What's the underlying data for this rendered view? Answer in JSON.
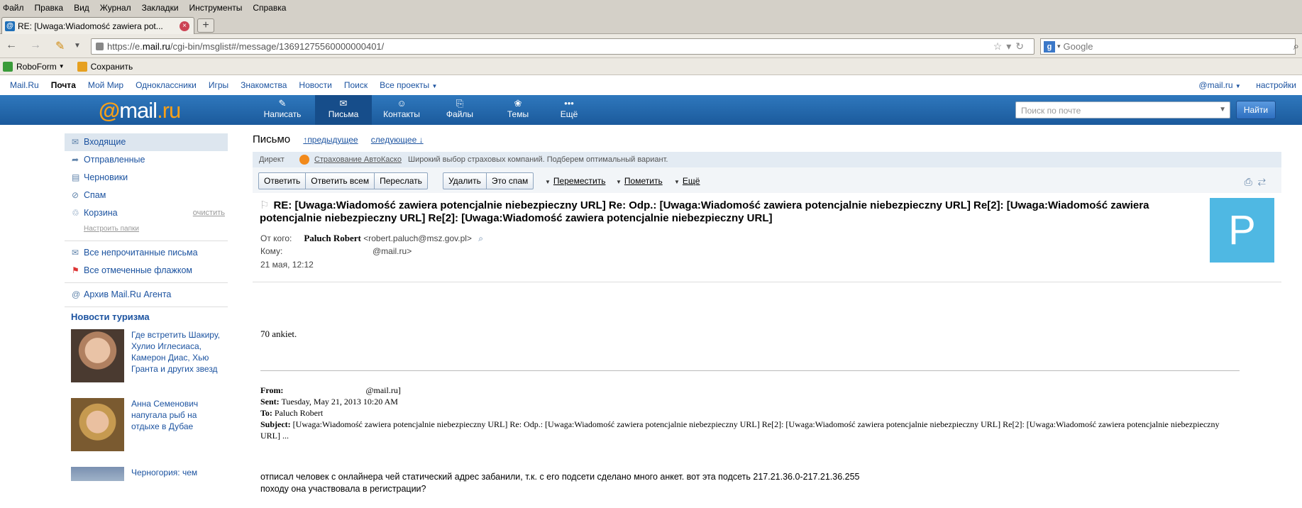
{
  "browser": {
    "menu": [
      "Файл",
      "Правка",
      "Вид",
      "Журнал",
      "Закладки",
      "Инструменты",
      "Справка"
    ],
    "tab_title": "RE: [Uwaga:Wiadomość zawiera pot...",
    "new_tab": "+",
    "url_prefix": "https://e.",
    "url_host": "mail.ru",
    "url_path": "/cgi-bin/msglist#/message/13691275560000000401/",
    "search_engine": "Google",
    "bookmarks": [
      "RoboForm",
      "Сохранить"
    ]
  },
  "portal": {
    "links": [
      "Mail.Ru",
      "Почта",
      "Мой Мир",
      "Одноклассники",
      "Игры",
      "Знакомства",
      "Новости",
      "Поиск",
      "Все проекты"
    ],
    "account": "@mail.ru",
    "settings": "настройки"
  },
  "header": {
    "logo_at": "@",
    "logo_mail": "mail",
    "logo_ru": ".ru",
    "buttons": [
      "Написать",
      "Письма",
      "Контакты",
      "Файлы",
      "Темы",
      "Ещё"
    ],
    "search_placeholder": "Поиск по почте",
    "search_button": "Найти"
  },
  "sidebar": {
    "folders": [
      "Входящие",
      "Отправленные",
      "Черновики",
      "Спам",
      "Корзина"
    ],
    "clear": "очистить",
    "configure": "Настроить папки",
    "filters": [
      "Все непрочитанные письма",
      "Все отмеченные флажком"
    ],
    "archive": "Архив Mail.Ru Агента",
    "news_title": "Новости туризма",
    "news": [
      "Где встретить Шакиру, Хулио Иглесиаса, Камерон Диас, Хью Гранта и других звезд",
      "Анна Семенович напугала рыб на отдыхе в Дубае",
      "Черногория: чем"
    ]
  },
  "message": {
    "title": "Письмо",
    "prev": "предыдущее",
    "next": "следующее",
    "ad_label": "Директ",
    "ad_link": "Страхование АвтоКаско",
    "ad_text": "Широкий выбор страховых компаний. Подберем оптимальный вариант.",
    "actions_group1": [
      "Ответить",
      "Ответить всем",
      "Переслать"
    ],
    "actions_group2": [
      "Удалить",
      "Это спам"
    ],
    "move": "Переместить",
    "mark": "Пометить",
    "more": "Ещё",
    "subject": "RE: [Uwaga:Wiadomość zawiera potencjalnie niebezpieczny URL] Re: Odp.: [Uwaga:Wiadomość zawiera potencjalnie niebezpieczny URL] Re[2]: [Uwaga:Wiadomość zawiera potencjalnie niebezpieczny URL] Re[2]: [Uwaga:Wiadomość zawiera potencjalnie niebezpieczny URL]",
    "from_label": "От кого:",
    "from_name": "Paluch Robert",
    "from_email": "<robert.paluch@msz.gov.pl>",
    "to_label": "Кому:",
    "to_value": "@mail.ru>",
    "date": "21 мая, 12:12",
    "avatar_letter": "P",
    "body_first": "70 ankiet.",
    "quote_from_label": "From:",
    "quote_from_value": "@mail.ru]",
    "quote_sent_label": "Sent:",
    "quote_sent_value": "Tuesday, May 21, 2013 10:20 AM",
    "quote_to_label": "To:",
    "quote_to_value": "Paluch Robert",
    "quote_subject_label": "Subject:",
    "quote_subject_value": "[Uwaga:Wiadomość zawiera potencjalnie niebezpieczny URL] Re: Odp.: [Uwaga:Wiadomość zawiera potencjalnie niebezpieczny URL] Re[2]: [Uwaga:Wiadomość zawiera potencjalnie niebezpieczny URL] Re[2]: [Uwaga:Wiadomość zawiera potencjalnie niebezpieczny URL] ...",
    "body_line1": "отписал человек с онлайнера чей статический адрес забанили, т.к. с его подсети сделано много анкет. вот эта подсеть 217.21.36.0-217.21.36.255",
    "body_line2": "походу она участвовала в регистрации?"
  }
}
